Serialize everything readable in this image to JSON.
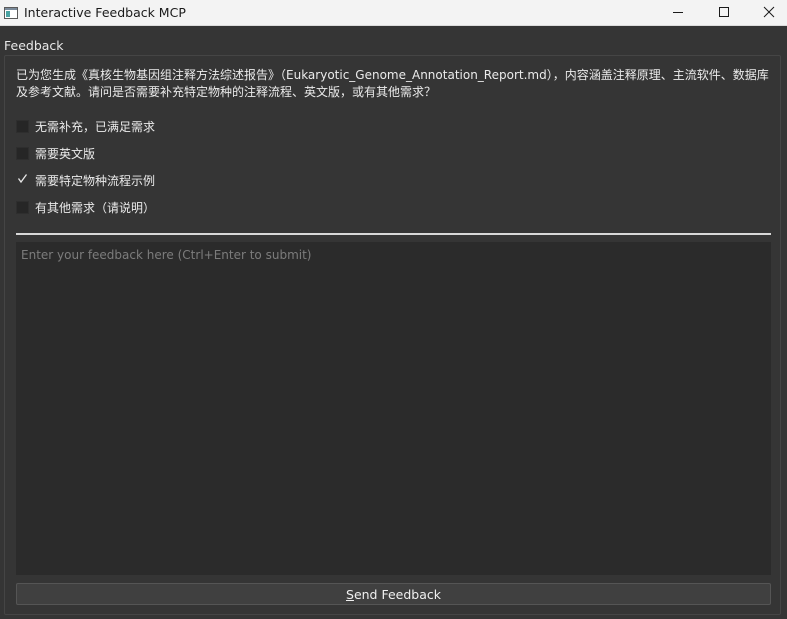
{
  "window": {
    "title": "Interactive Feedback MCP",
    "icons": {
      "app": "app-window-icon",
      "minimize": "minimize-icon",
      "maximize": "maximize-icon",
      "close": "close-icon"
    }
  },
  "group": {
    "title": "Feedback"
  },
  "message": "已为您生成《真核生物基因组注释方法综述报告》（Eukaryotic_Genome_Annotation_Report.md），内容涵盖注释原理、主流软件、数据库及参考文献。请问是否需要补充特定物种的注释流程、英文版，或有其他需求？",
  "options": [
    {
      "label": "无需补充，已满足需求",
      "checked": false
    },
    {
      "label": "需要英文版",
      "checked": false
    },
    {
      "label": "需要特定物种流程示例",
      "checked": true
    },
    {
      "label": "有其他需求（请说明）",
      "checked": false
    }
  ],
  "feedback": {
    "value": "",
    "placeholder": "Enter your feedback here (Ctrl+Enter to submit)"
  },
  "send_button": {
    "mnemonic": "S",
    "rest": "end Feedback"
  },
  "colors": {
    "background": "#353535",
    "titlebar": "#f3f3f3",
    "input_background": "#2b2b2b",
    "text": "#ebebeb",
    "placeholder": "#7c7c7c"
  }
}
